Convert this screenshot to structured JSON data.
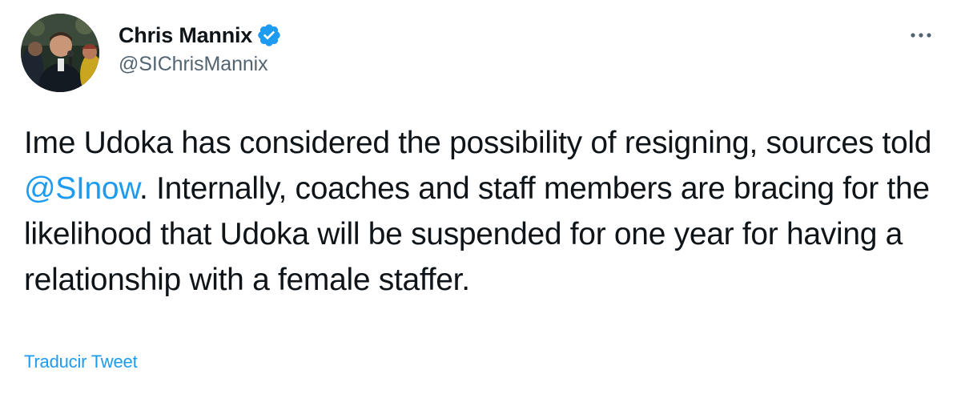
{
  "author": {
    "display_name": "Chris Mannix",
    "handle": "@SIChrisMannix",
    "verified": true
  },
  "tweet": {
    "text_part1": "Ime Udoka has considered the possibility of resigning, sources told ",
    "mention": "@SInow",
    "text_part2": ". Internally, coaches and staff members are bracing for the likelihood that Udoka will be suspended for one year for having a relationship with a female staffer."
  },
  "actions": {
    "translate_label": "Traducir Tweet",
    "more_icon": "more-horizontal-icon"
  },
  "colors": {
    "link": "#1d9bf0",
    "text": "#0f1419",
    "secondary": "#536471",
    "verified": "#1d9bf0"
  }
}
